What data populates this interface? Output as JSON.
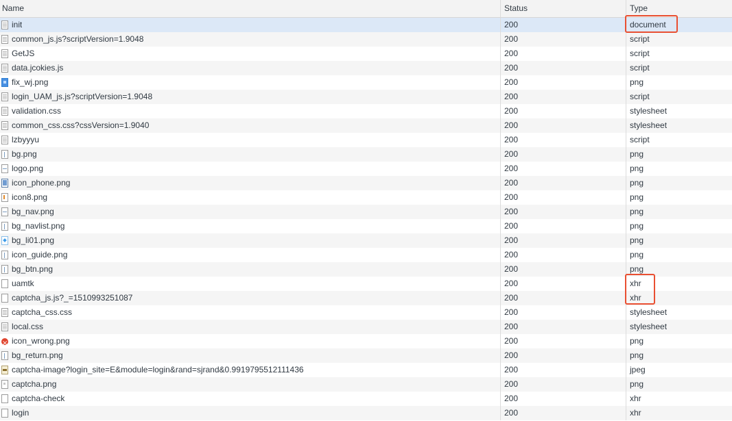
{
  "columns": {
    "name": "Name",
    "status": "Status",
    "type": "Type"
  },
  "requests": [
    {
      "name": "init",
      "status": "200",
      "type": "document",
      "icon": "document-icon"
    },
    {
      "name": "common_js.js?scriptVersion=1.9048",
      "status": "200",
      "type": "script",
      "icon": "script-icon"
    },
    {
      "name": "GetJS",
      "status": "200",
      "type": "script",
      "icon": "script-icon"
    },
    {
      "name": "data.jcokies.js",
      "status": "200",
      "type": "script",
      "icon": "script-icon"
    },
    {
      "name": "fix_wj.png",
      "status": "200",
      "type": "png",
      "icon": "image-icon"
    },
    {
      "name": "login_UAM_js.js?scriptVersion=1.9048",
      "status": "200",
      "type": "script",
      "icon": "script-icon"
    },
    {
      "name": "validation.css",
      "status": "200",
      "type": "stylesheet",
      "icon": "stylesheet-icon"
    },
    {
      "name": "common_css.css?cssVersion=1.9040",
      "status": "200",
      "type": "stylesheet",
      "icon": "stylesheet-icon"
    },
    {
      "name": "lzbyyyu",
      "status": "200",
      "type": "script",
      "icon": "script-icon"
    },
    {
      "name": "bg.png",
      "status": "200",
      "type": "png",
      "icon": "image-icon"
    },
    {
      "name": "logo.png",
      "status": "200",
      "type": "png",
      "icon": "image-icon"
    },
    {
      "name": "icon_phone.png",
      "status": "200",
      "type": "png",
      "icon": "image-icon"
    },
    {
      "name": "icon8.png",
      "status": "200",
      "type": "png",
      "icon": "image-icon"
    },
    {
      "name": "bg_nav.png",
      "status": "200",
      "type": "png",
      "icon": "image-icon"
    },
    {
      "name": "bg_navlist.png",
      "status": "200",
      "type": "png",
      "icon": "image-icon"
    },
    {
      "name": "bg_li01.png",
      "status": "200",
      "type": "png",
      "icon": "image-icon"
    },
    {
      "name": "icon_guide.png",
      "status": "200",
      "type": "png",
      "icon": "image-icon"
    },
    {
      "name": "bg_btn.png",
      "status": "200",
      "type": "png",
      "icon": "image-icon"
    },
    {
      "name": "uamtk",
      "status": "200",
      "type": "xhr",
      "icon": "xhr-icon"
    },
    {
      "name": "captcha_js.js?_=1510993251087",
      "status": "200",
      "type": "xhr",
      "icon": "xhr-icon"
    },
    {
      "name": "captcha_css.css",
      "status": "200",
      "type": "stylesheet",
      "icon": "stylesheet-icon"
    },
    {
      "name": "local.css",
      "status": "200",
      "type": "stylesheet",
      "icon": "stylesheet-icon"
    },
    {
      "name": "icon_wrong.png",
      "status": "200",
      "type": "png",
      "icon": "image-icon"
    },
    {
      "name": "bg_return.png",
      "status": "200",
      "type": "png",
      "icon": "image-icon"
    },
    {
      "name": "captcha-image?login_site=E&module=login&rand=sjrand&0.9919795512111436",
      "status": "200",
      "type": "jpeg",
      "icon": "image-icon"
    },
    {
      "name": "captcha.png",
      "status": "200",
      "type": "png",
      "icon": "image-icon"
    },
    {
      "name": "captcha-check",
      "status": "200",
      "type": "xhr",
      "icon": "xhr-icon"
    },
    {
      "name": "login",
      "status": "200",
      "type": "xhr",
      "icon": "xhr-icon"
    }
  ],
  "selected_row": 0,
  "colors": {
    "highlight_box": "#e94f31",
    "selected_row": "#dce8f7"
  }
}
